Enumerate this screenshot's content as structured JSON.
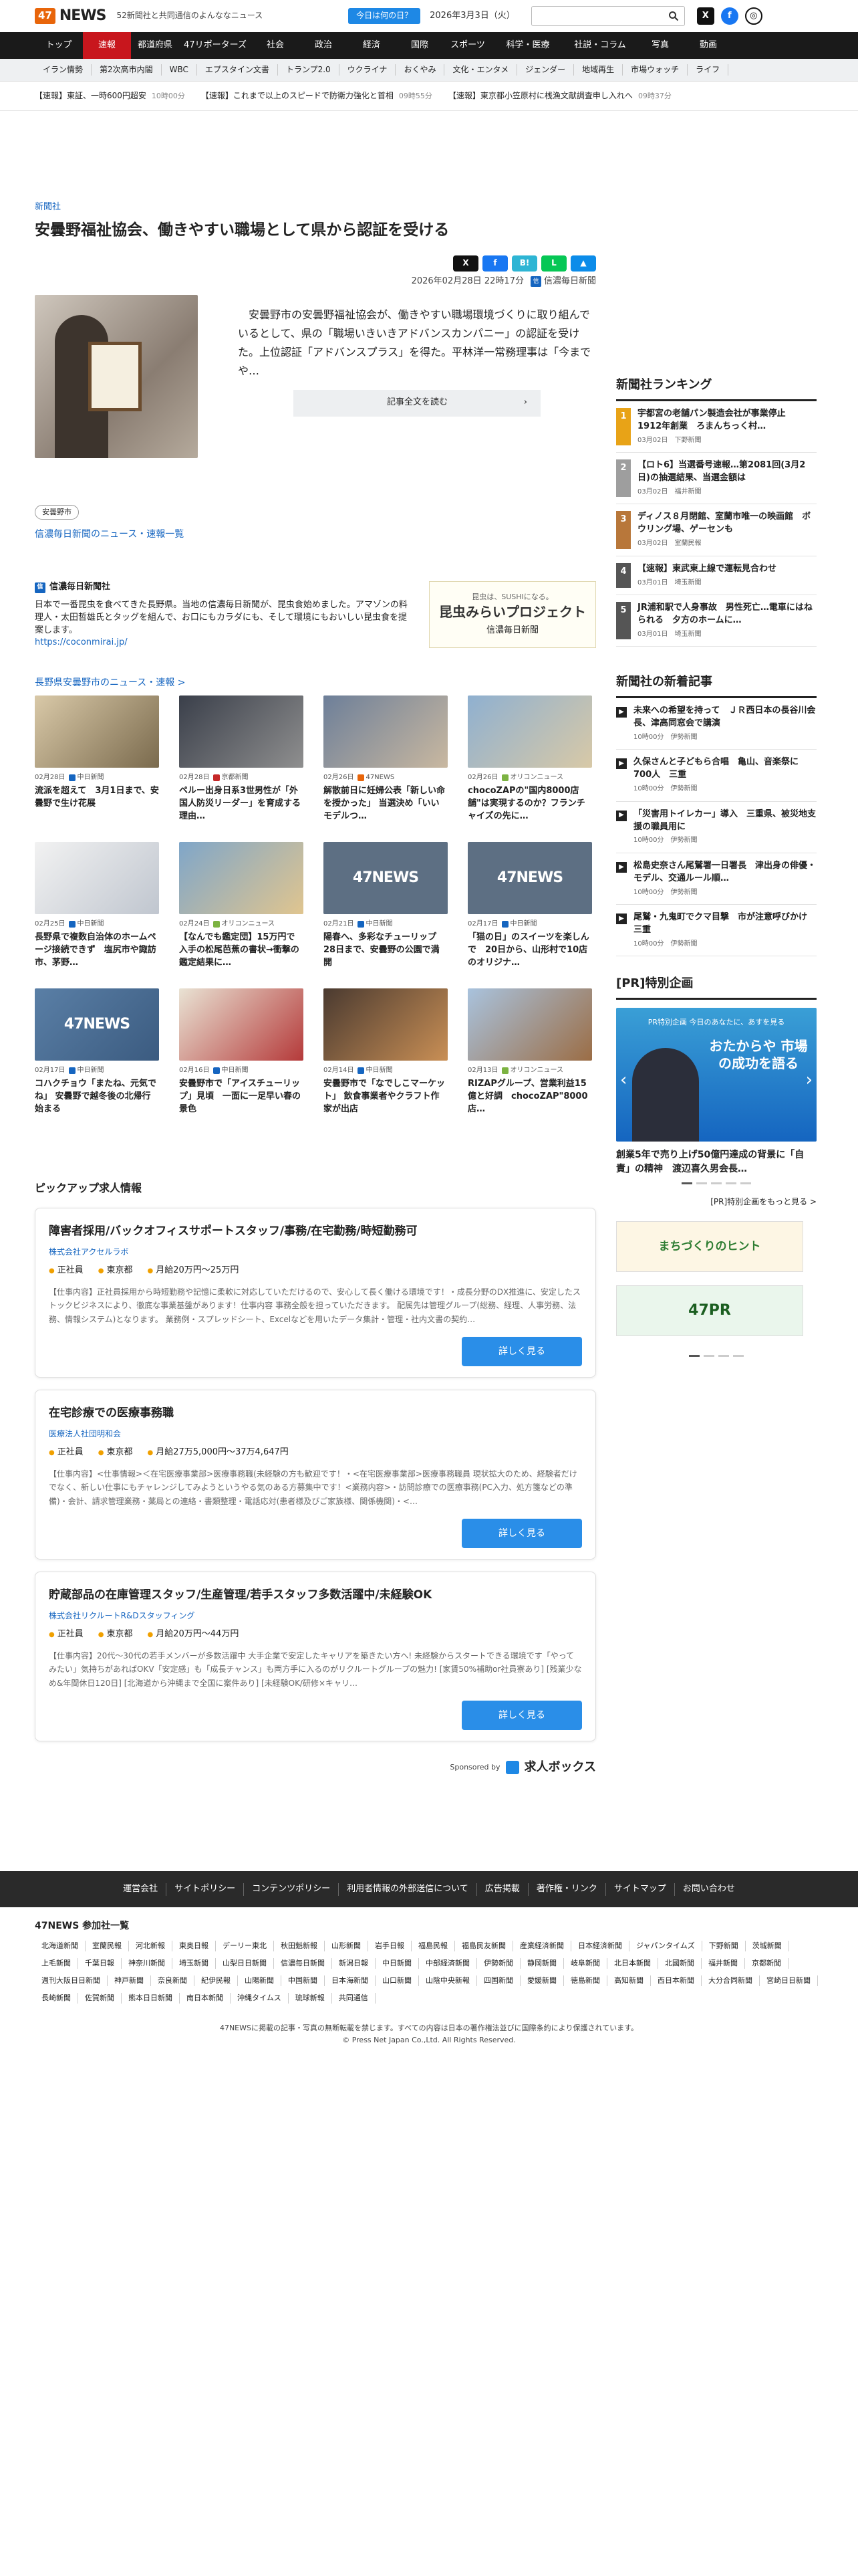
{
  "header": {
    "logo_mark": "47",
    "logo_text": "NEWS",
    "tagline": "52新聞社と共同通信のよんななニュース",
    "today_label": "今日は何の日？",
    "date": "2026年3月3日（火）",
    "search_placeholder": ""
  },
  "main_nav": [
    "トップ",
    "速報",
    "都道府県",
    "47リポーターズ",
    "社会",
    "政治",
    "経済",
    "国際",
    "スポーツ",
    "科学・医療",
    "社説・コラム",
    "写真",
    "動画"
  ],
  "sub_nav": [
    "イラン情勢",
    "第2次高市内閣",
    "WBC",
    "エプスタイン文書",
    "トランプ2.0",
    "ウクライナ",
    "おくやみ",
    "文化・エンタメ",
    "ジェンダー",
    "地域再生",
    "市場ウォッチ",
    "ライフ"
  ],
  "ticker": [
    {
      "text": "【速報】東証、一時600円超安",
      "time": "10時00分"
    },
    {
      "text": "【速報】これまで以上のスピードで防衛力強化と首相",
      "time": "09時55分"
    },
    {
      "text": "【速報】東京都小笠原村に桟漁文献調査申し入れへ",
      "time": "09時37分"
    }
  ],
  "article": {
    "kicker": "新聞社",
    "title": "安曇野福祉協会、働きやすい職場として県から認証を受ける",
    "datetime": "2026年02月28日 22時17分",
    "publisher": "信濃毎日新聞",
    "lead": "安曇野市の安曇野福祉協会が、働きやすい職場環境づくりに取り組んでいるとして、県の「職場いきいきアドバンスカンパニー」の認証を受けた。上位認証「アドバンスプラス」を得た。平林洋一常務理事は「今までや…",
    "readmore": "記事全文を読む"
  },
  "tag": "安曇野市",
  "link_newslist": "信濃毎日新聞のニュース・速報一覧",
  "pr": {
    "name": "信濃毎日新聞社",
    "text": "日本で一番昆虫を食べてきた長野県。当地の信濃毎日新聞が、昆虫食始めました。アマゾンの料理人・太田哲雄氏とタッグを組んで、お口にもカラダにも、そして環境にもおいしい昆虫食を提案します。",
    "url": "https://coconmirai.jp/",
    "banner_sub": "昆虫は、SUSHIになる。",
    "banner_main": "昆虫みらいプロジェクト",
    "banner_pub": "信濃毎日新聞"
  },
  "section_more": "長野県安曇野市のニュース・速報 >",
  "cards": [
    {
      "date": "02月28日",
      "src": "中日新聞",
      "title": "流派を超えて　3月1日まで、安曇野で生け花展"
    },
    {
      "date": "02月28日",
      "src": "京都新聞",
      "title": "ペルー出身日系3世男性が「外国人防災リーダー」を育成する理由…"
    },
    {
      "date": "02月26日",
      "src": "47NEWS",
      "title": "解散前日に妊婦公表「新しい命を授かった」 当選決め「いいモデルつ…"
    },
    {
      "date": "02月26日",
      "src": "オリコンニュース",
      "title": "chocoZAPの\"国内8000店舗\"は実現するのか？フランチャイズの先に…"
    },
    {
      "date": "02月25日",
      "src": "中日新聞",
      "title": "長野県で複数自治体のホームページ接続できず　塩尻市や諏訪市、茅野…"
    },
    {
      "date": "02月24日",
      "src": "オリコンニュース",
      "title": "【なんでも鑑定団】15万円で入手の松尾芭蕉の書状→衝撃の鑑定結果に…"
    },
    {
      "date": "02月21日",
      "src": "中日新聞",
      "title": "陽春へ、多彩なチューリップ　28日まで、安曇野の公園で満開"
    },
    {
      "date": "02月17日",
      "src": "中日新聞",
      "title": "「猫の日」のスイーツを楽しんで　20日から、山形村で10店のオリジナ…"
    },
    {
      "date": "02月17日",
      "src": "中日新聞",
      "title": "コハクチョウ「またね、元気でね」 安曇野で越冬後の北帰行始まる"
    },
    {
      "date": "02月16日",
      "src": "中日新聞",
      "title": "安曇野市で「アイスチューリップ」見頃　一面に一足早い春の景色"
    },
    {
      "date": "02月14日",
      "src": "中日新聞",
      "title": "安曇野市で「なでしこマーケット」 飲食事業者やクラフト作家が出店"
    },
    {
      "date": "02月13日",
      "src": "オリコンニュース",
      "title": "RIZAPグループ、営業利益15億と好調　chocoZAP\"8000店…"
    }
  ],
  "jobs": {
    "heading": "ピックアップ求人情報",
    "items": [
      {
        "title": "障害者採用/バックオフィスサポートスタッフ/事務/在宅勤務/時短勤務可",
        "company": "株式会社アクセルラボ",
        "type": "正社員",
        "location": "東京都",
        "salary": "月給20万円〜25万円",
        "desc": "【仕事内容】正社員採用から時短勤務や記憶に柔軟に対応していただけるので、安心して長く働ける環境です！・成長分野のDX推進に、安定したストックビジネスにより、徹底な事業基盤があります！仕事内容 事務全般を担っていただきます。 配属先は管理グループ(総務、経理、人事労務、法務、情報システム)となります。 業務例・スプレッドシート、Excelなどを用いたデータ集計・管理・社内文書の契約…",
        "more": "詳しく見る"
      },
      {
        "title": "在宅診療での医療事務職",
        "company": "医療法人社団明和会",
        "type": "正社員",
        "location": "東京都",
        "salary": "月給27万5,000円〜37万4,647円",
        "desc": "【仕事内容】<仕事情報>＜在宅医療事業部>医療事務職(未経験の方も歓迎です！・<在宅医療事業部>医療事務職員 現状拡大のため、経験者だけでなく、新しい仕事にもチャレンジしてみようというやる気のある方募集中です！<業務内容>・訪問診療での医療事務(PC入力、処方箋などの準備)・会計、請求管理業務・薬局との連絡・書類整理・電話応対(患者様及びご家族様、関係機関)・<…",
        "more": "詳しく見る"
      },
      {
        "title": "貯蔵部品の在庫管理スタッフ/生産管理/若手スタッフ多数活躍中/未経験OK",
        "company": "株式会社リクルートR&Dスタッフィング",
        "type": "正社員",
        "location": "東京都",
        "salary": "月給20万円〜44万円",
        "desc": "【仕事内容】20代〜30代の若手メンバーが多数活躍中 大手企業で安定したキャリアを築きたい方へ! 未経験からスタートできる環境です「やってみたい」気持ちがあればOKV「安定感」も「成長チャンス」も両方手に入るのがリクルートグループの魅力! [家賃50%補助or社員寮あり] [残業少なめ&年間休日120日] [北海道から沖縄まで全国に案件あり] [未経験OK/研修×キャリ…",
        "more": "詳しく見る"
      }
    ],
    "sponsored_by": "Sponsored by",
    "sponsor_name": "求人ボックス"
  },
  "sidebar": {
    "ranking_title": "新聞社ランキング",
    "ranking": [
      {
        "title": "宇都宮の老舗パン製造会社が事業停止　1912年創業　ろまんちっく村…",
        "date": "03月02日",
        "src": "下野新聞",
        "color": "#e8a317"
      },
      {
        "title": "【ロト6】当選番号速報…第2081回(3月2日)の抽選結果、当選金額は",
        "date": "03月02日",
        "src": "福井新聞",
        "color": "#9e9e9e"
      },
      {
        "title": "ディノス８月閉館、室蘭市唯一の映画館　ボウリング場、ゲーセンも",
        "date": "03月02日",
        "src": "室蘭民報",
        "color": "#b8773a"
      },
      {
        "title": "【速報】東武東上線で運転見合わせ",
        "date": "03月01日",
        "src": "埼玉新聞",
        "color": "#555555"
      },
      {
        "title": "JR浦和駅で人身事故　男性死亡…電車にはねられる　夕方のホームに…",
        "date": "03月01日",
        "src": "埼玉新聞",
        "color": "#555555"
      }
    ],
    "new_title": "新聞社の新着記事",
    "new_items": [
      {
        "title": "未来への希望を持って　ＪＲ西日本の長谷川会長、津高同窓会で講演",
        "time": "10時00分",
        "src": "伊勢新聞"
      },
      {
        "title": "久保さんと子どもら合唱　亀山、音楽祭に700人　三重",
        "time": "10時00分",
        "src": "伊勢新聞"
      },
      {
        "title": "「災害用トイレカー」導入　三重県、被災地支援の職員用に",
        "time": "10時00分",
        "src": "伊勢新聞"
      },
      {
        "title": "松島史奈さん尾鷲署一日署長　津出身の俳優・モデル、交通ルール順…",
        "time": "10時00分",
        "src": "伊勢新聞"
      },
      {
        "title": "尾鷲・九鬼町でクマ目撃　市が注意呼びかけ　三重",
        "time": "10時00分",
        "src": "伊勢新聞"
      }
    ],
    "special_title": "[PR]特別企画",
    "special_top": "PR特別企画 今日のあなたに、あすを見る",
    "special_main": "おたからや 市場の成功を語る",
    "special_caption": "創業5年で売り上げ50億円達成の背景に「自責」の精神　渡辺喜久男会長…",
    "special_more": "[PR]特別企画をもっと見る >",
    "banner1": "まちづくりのヒント",
    "banner2": "47PR"
  },
  "footer": {
    "links": [
      "運営会社",
      "サイトポリシー",
      "コンテンツポリシー",
      "利用者情報の外部送信について",
      "広告掲載",
      "著作権・リンク",
      "サイトマップ",
      "お問い合わせ"
    ],
    "members_title": "47NEWS 参加社一覧",
    "members": [
      "北海道新聞",
      "室蘭民報",
      "河北新報",
      "東奥日報",
      "デーリー東北",
      "秋田魁新報",
      "山形新聞",
      "岩手日報",
      "福島民報",
      "福島民友新聞",
      "産業経済新聞",
      "日本経済新聞",
      "ジャパンタイムズ",
      "下野新聞",
      "茨城新聞",
      "上毛新聞",
      "千葉日報",
      "神奈川新聞",
      "埼玉新聞",
      "山梨日日新聞",
      "信濃毎日新聞",
      "新潟日報",
      "中日新聞",
      "中部経済新聞",
      "伊勢新聞",
      "静岡新聞",
      "岐阜新聞",
      "北日本新聞",
      "北國新聞",
      "福井新聞",
      "京都新聞",
      "週刊大阪日日新聞",
      "神戸新聞",
      "奈良新聞",
      "紀伊民報",
      "山陽新聞",
      "中国新聞",
      "日本海新聞",
      "山口新聞",
      "山陰中央新報",
      "四国新聞",
      "愛媛新聞",
      "徳島新聞",
      "高知新聞",
      "西日本新聞",
      "大分合同新聞",
      "宮崎日日新聞",
      "長崎新聞",
      "佐賀新聞",
      "熊本日日新聞",
      "南日本新聞",
      "沖縄タイムス",
      "琉球新報",
      "共同通信"
    ],
    "notice": "47NEWSに掲載の記事・写真の無断転載を禁じます。すべての内容は日本の著作権法並びに国際条約により保護されています。",
    "copyright": "© Press Net Japan Co.,Ltd. All Rights Reserved."
  }
}
